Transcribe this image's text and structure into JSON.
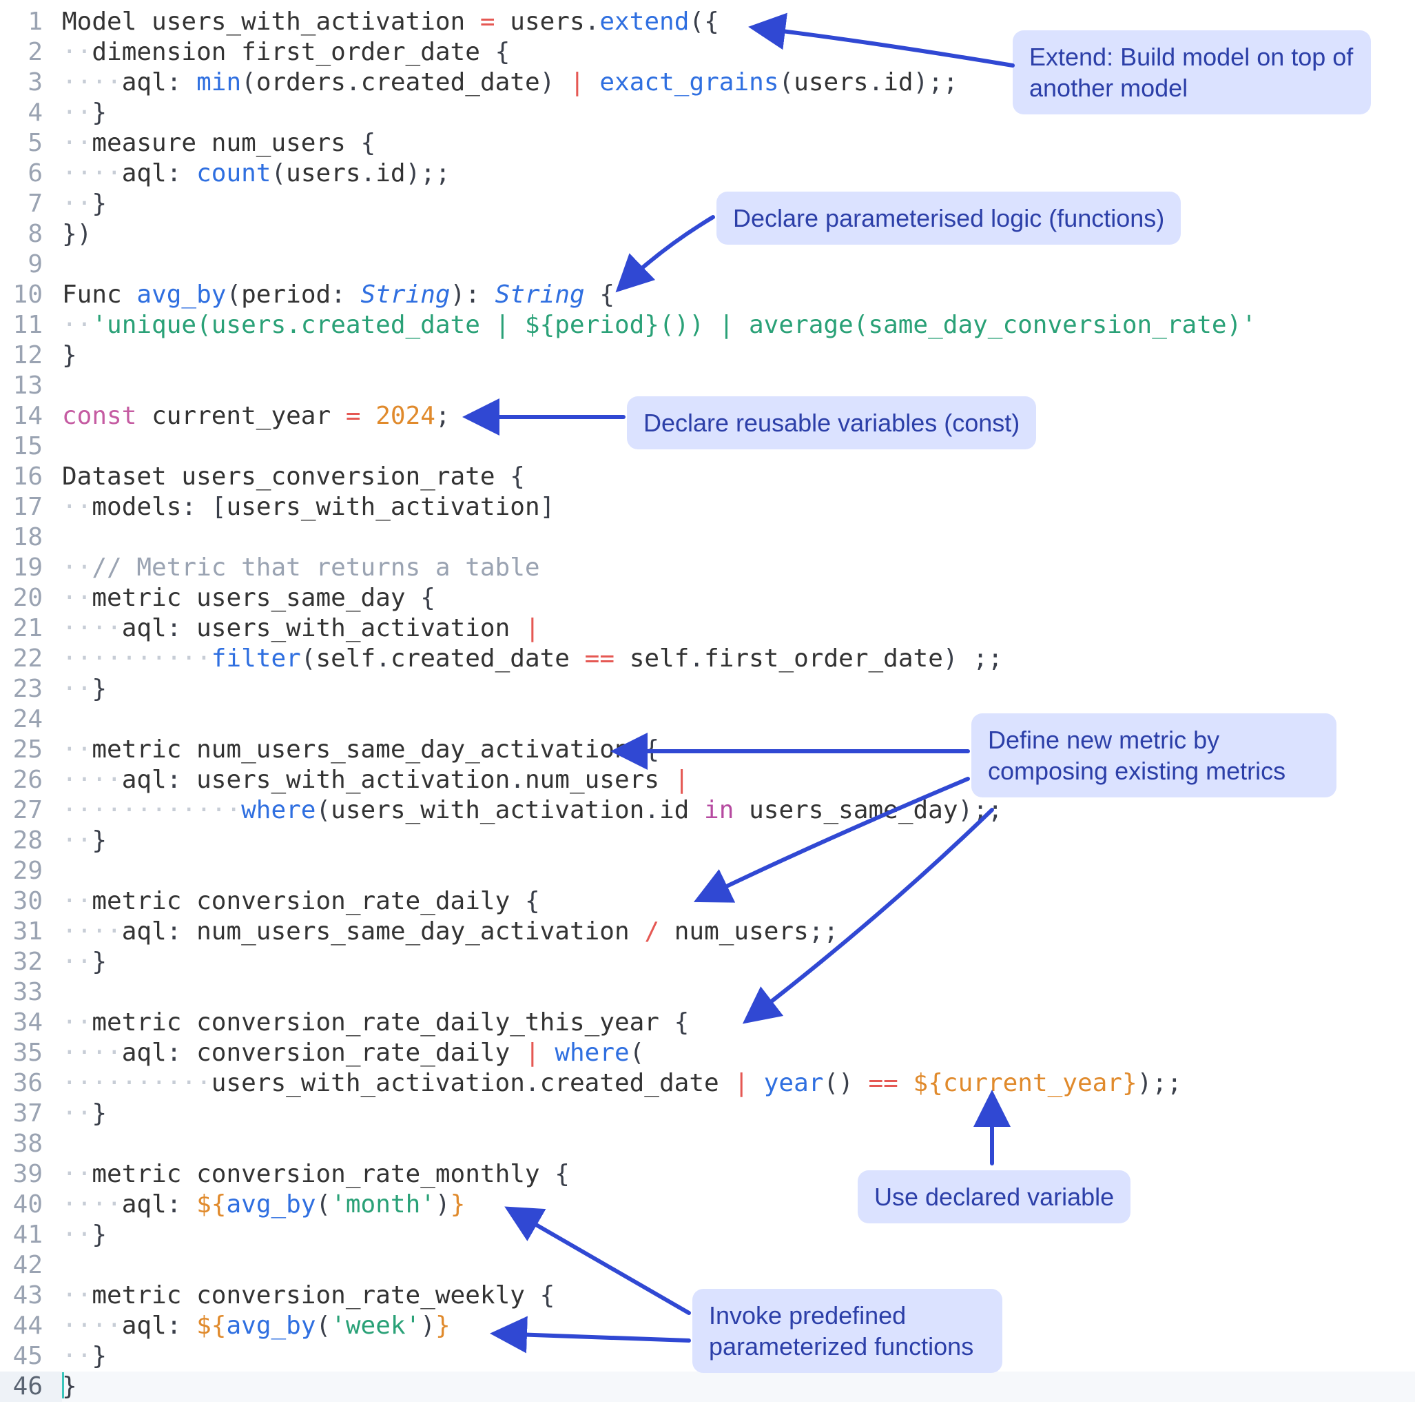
{
  "editor": {
    "lines": [
      {
        "n": 1,
        "html": "<span class='tok-deftype'>Model</span> <span class='tok-ident'>users_with_activation</span> <span class='tok-op'>=</span> <span class='tok-ident'>users</span><span class='tok-punct'>.</span><span class='tok-func'>extend</span><span class='tok-punct'>({</span>"
      },
      {
        "n": 2,
        "html": "<span class='ind'>··</span><span class='tok-ident'>dimension</span> <span class='tok-ident'>first_order_date</span> <span class='tok-punct'>{</span>"
      },
      {
        "n": 3,
        "html": "<span class='ind'>····</span><span class='tok-key'>aql</span><span class='tok-punct'>:</span> <span class='tok-func'>min</span><span class='tok-punct'>(</span><span class='tok-ident'>orders</span><span class='tok-punct'>.</span><span class='tok-ident'>created_date</span><span class='tok-punct'>)</span> <span class='tok-op'>|</span> <span class='tok-func'>exact_grains</span><span class='tok-punct'>(</span><span class='tok-ident'>users</span><span class='tok-punct'>.</span><span class='tok-ident'>id</span><span class='tok-punct'>);;</span>"
      },
      {
        "n": 4,
        "html": "<span class='ind'>··</span><span class='tok-punct'>}</span>"
      },
      {
        "n": 5,
        "html": "<span class='ind'>··</span><span class='tok-ident'>measure</span> <span class='tok-ident'>num_users</span> <span class='tok-punct'>{</span>"
      },
      {
        "n": 6,
        "html": "<span class='ind'>····</span><span class='tok-key'>aql</span><span class='tok-punct'>:</span> <span class='tok-func'>count</span><span class='tok-punct'>(</span><span class='tok-ident'>users</span><span class='tok-punct'>.</span><span class='tok-ident'>id</span><span class='tok-punct'>);;</span>"
      },
      {
        "n": 7,
        "html": "<span class='ind'>··</span><span class='tok-punct'>}</span>"
      },
      {
        "n": 8,
        "html": "<span class='tok-punct'>})</span>"
      },
      {
        "n": 9,
        "html": ""
      },
      {
        "n": 10,
        "html": "<span class='tok-deftype'>Func</span> <span class='tok-func'>avg_by</span><span class='tok-punct'>(</span><span class='tok-ident'>period</span><span class='tok-punct'>:</span> <span class='tok-type'>String</span><span class='tok-punct'>)</span><span class='tok-punct'>:</span> <span class='tok-type'>String</span> <span class='tok-punct'>{</span>"
      },
      {
        "n": 11,
        "html": "<span class='ind'>··</span><span class='tok-string'>'unique(users.created_date | ${period}()) | average(same_day_conversion_rate)'</span>"
      },
      {
        "n": 12,
        "html": "<span class='tok-punct'>}</span>"
      },
      {
        "n": 13,
        "html": ""
      },
      {
        "n": 14,
        "html": "<span class='tok-keyword'>const</span> <span class='tok-ident'>current_year</span> <span class='tok-op'>=</span> <span class='tok-number'>2024</span><span class='tok-punct'>;</span>"
      },
      {
        "n": 15,
        "html": ""
      },
      {
        "n": 16,
        "html": "<span class='tok-deftype'>Dataset</span> <span class='tok-ident'>users_conversion_rate</span> <span class='tok-punct'>{</span>"
      },
      {
        "n": 17,
        "html": "<span class='ind'>··</span><span class='tok-key'>models</span><span class='tok-punct'>:</span> <span class='tok-punct'>[</span><span class='tok-ident'>users_with_activation</span><span class='tok-punct'>]</span>"
      },
      {
        "n": 18,
        "html": ""
      },
      {
        "n": 19,
        "html": "<span class='ind'>··</span><span class='tok-comment'>// Metric that returns a table</span>"
      },
      {
        "n": 20,
        "html": "<span class='ind'>··</span><span class='tok-ident'>metric</span> <span class='tok-ident'>users_same_day</span> <span class='tok-punct'>{</span>"
      },
      {
        "n": 21,
        "html": "<span class='ind'>····</span><span class='tok-key'>aql</span><span class='tok-punct'>:</span> <span class='tok-ident'>users_with_activation</span> <span class='tok-op'>|</span>"
      },
      {
        "n": 22,
        "html": "<span class='ind'>··········</span><span class='tok-func'>filter</span><span class='tok-punct'>(</span><span class='tok-ident'>self</span><span class='tok-punct'>.</span><span class='tok-ident'>created_date</span> <span class='tok-op'>==</span> <span class='tok-ident'>self</span><span class='tok-punct'>.</span><span class='tok-ident'>first_order_date</span><span class='tok-punct'>)</span> <span class='tok-punct'>;;</span>"
      },
      {
        "n": 23,
        "html": "<span class='ind'>··</span><span class='tok-punct'>}</span>"
      },
      {
        "n": 24,
        "html": ""
      },
      {
        "n": 25,
        "html": "<span class='ind'>··</span><span class='tok-ident'>metric</span> <span class='tok-ident'>num_users_same_day_activation</span> <span class='tok-punct'>{</span>"
      },
      {
        "n": 26,
        "html": "<span class='ind'>····</span><span class='tok-key'>aql</span><span class='tok-punct'>:</span> <span class='tok-ident'>users_with_activation</span><span class='tok-punct'>.</span><span class='tok-ident'>num_users</span> <span class='tok-op'>|</span>"
      },
      {
        "n": 27,
        "html": "<span class='ind'>············</span><span class='tok-func'>where</span><span class='tok-punct'>(</span><span class='tok-ident'>users_with_activation</span><span class='tok-punct'>.</span><span class='tok-ident'>id</span> <span class='tok-key2'>in</span> <span class='tok-ident'>users_same_day</span><span class='tok-punct'>);;</span>"
      },
      {
        "n": 28,
        "html": "<span class='ind'>··</span><span class='tok-punct'>}</span>"
      },
      {
        "n": 29,
        "html": ""
      },
      {
        "n": 30,
        "html": "<span class='ind'>··</span><span class='tok-ident'>metric</span> <span class='tok-ident'>conversion_rate_daily</span> <span class='tok-punct'>{</span>"
      },
      {
        "n": 31,
        "html": "<span class='ind'>····</span><span class='tok-key'>aql</span><span class='tok-punct'>:</span> <span class='tok-ident'>num_users_same_day_activation</span> <span class='tok-op'>/</span> <span class='tok-ident'>num_users</span><span class='tok-punct'>;;</span>"
      },
      {
        "n": 32,
        "html": "<span class='ind'>··</span><span class='tok-punct'>}</span>"
      },
      {
        "n": 33,
        "html": ""
      },
      {
        "n": 34,
        "html": "<span class='ind'>··</span><span class='tok-ident'>metric</span> <span class='tok-ident'>conversion_rate_daily_this_year</span> <span class='tok-punct'>{</span>"
      },
      {
        "n": 35,
        "html": "<span class='ind'>····</span><span class='tok-key'>aql</span><span class='tok-punct'>:</span> <span class='tok-ident'>conversion_rate_daily</span> <span class='tok-op'>|</span> <span class='tok-func'>where</span><span class='tok-punct'>(</span>"
      },
      {
        "n": 36,
        "html": "<span class='ind'>··········</span><span class='tok-ident'>users_with_activation</span><span class='tok-punct'>.</span><span class='tok-ident'>created_date</span> <span class='tok-op'>|</span> <span class='tok-func'>year</span><span class='tok-punct'>()</span> <span class='tok-op'>==</span> <span class='tok-var'>${current_year}</span><span class='tok-punct'>);;</span>"
      },
      {
        "n": 37,
        "html": "<span class='ind'>··</span><span class='tok-punct'>}</span>"
      },
      {
        "n": 38,
        "html": ""
      },
      {
        "n": 39,
        "html": "<span class='ind'>··</span><span class='tok-ident'>metric</span> <span class='tok-ident'>conversion_rate_monthly</span> <span class='tok-punct'>{</span>"
      },
      {
        "n": 40,
        "html": "<span class='ind'>····</span><span class='tok-key'>aql</span><span class='tok-punct'>:</span> <span class='tok-var'>${</span><span class='tok-func'>avg_by</span><span class='tok-punct'>(</span><span class='tok-string'>'month'</span><span class='tok-punct'>)</span><span class='tok-var'>}</span>"
      },
      {
        "n": 41,
        "html": "<span class='ind'>··</span><span class='tok-punct'>}</span>"
      },
      {
        "n": 42,
        "html": ""
      },
      {
        "n": 43,
        "html": "<span class='ind'>··</span><span class='tok-ident'>metric</span> <span class='tok-ident'>conversion_rate_weekly</span> <span class='tok-punct'>{</span>"
      },
      {
        "n": 44,
        "html": "<span class='ind'>····</span><span class='tok-key'>aql</span><span class='tok-punct'>:</span> <span class='tok-var'>${</span><span class='tok-func'>avg_by</span><span class='tok-punct'>(</span><span class='tok-string'>'week'</span><span class='tok-punct'>)</span><span class='tok-var'>}</span>"
      },
      {
        "n": 45,
        "html": "<span class='ind'>··</span><span class='tok-punct'>}</span>"
      },
      {
        "n": 46,
        "html": "<span class='cursor'></span><span class='tok-punct'>}</span>",
        "active": true
      }
    ]
  },
  "annotations": {
    "extend": "Extend: Build model on top of another model",
    "funcs": "Declare parameterised logic (functions)",
    "const": "Declare reusable variables (const)",
    "compose": "Define new metric by composing existing metrics",
    "usevar": "Use declared variable",
    "invoke": "Invoke predefined parameterized functions"
  }
}
